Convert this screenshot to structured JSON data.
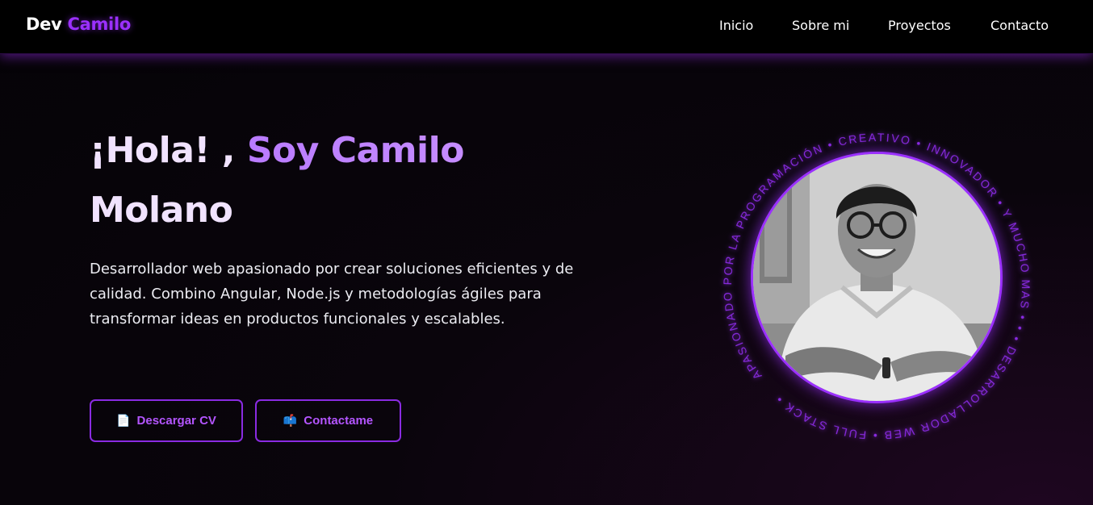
{
  "brand": {
    "first": "Dev",
    "second": "Camilo"
  },
  "nav": {
    "items": [
      "Inicio",
      "Sobre mi",
      "Proyectos",
      "Contacto"
    ]
  },
  "hero": {
    "greeting": "¡Hola! , ",
    "name_highlight": "Soy Camilo",
    "surname": "Molano",
    "description": "Desarrollador web apasionado por crear soluciones eficientes y de calidad. Combino Angular, Node.js y metodologías ágiles para transformar ideas en productos funcionales y escalables.",
    "buttons": [
      {
        "icon": "📄",
        "label": "Descargar CV"
      },
      {
        "icon": "📫",
        "label": "Contactame"
      }
    ]
  },
  "badge": {
    "ring_text": "APASIONADO POR LA PROGRAMACIÓN • CREATIVO • INNOVADOR • Y MUCHO MAS • • • DESARROLLADOR WEB • FULL STACK •"
  },
  "colors": {
    "accent": "#9b30ff",
    "background": "#050307",
    "navbar": "#000000"
  }
}
